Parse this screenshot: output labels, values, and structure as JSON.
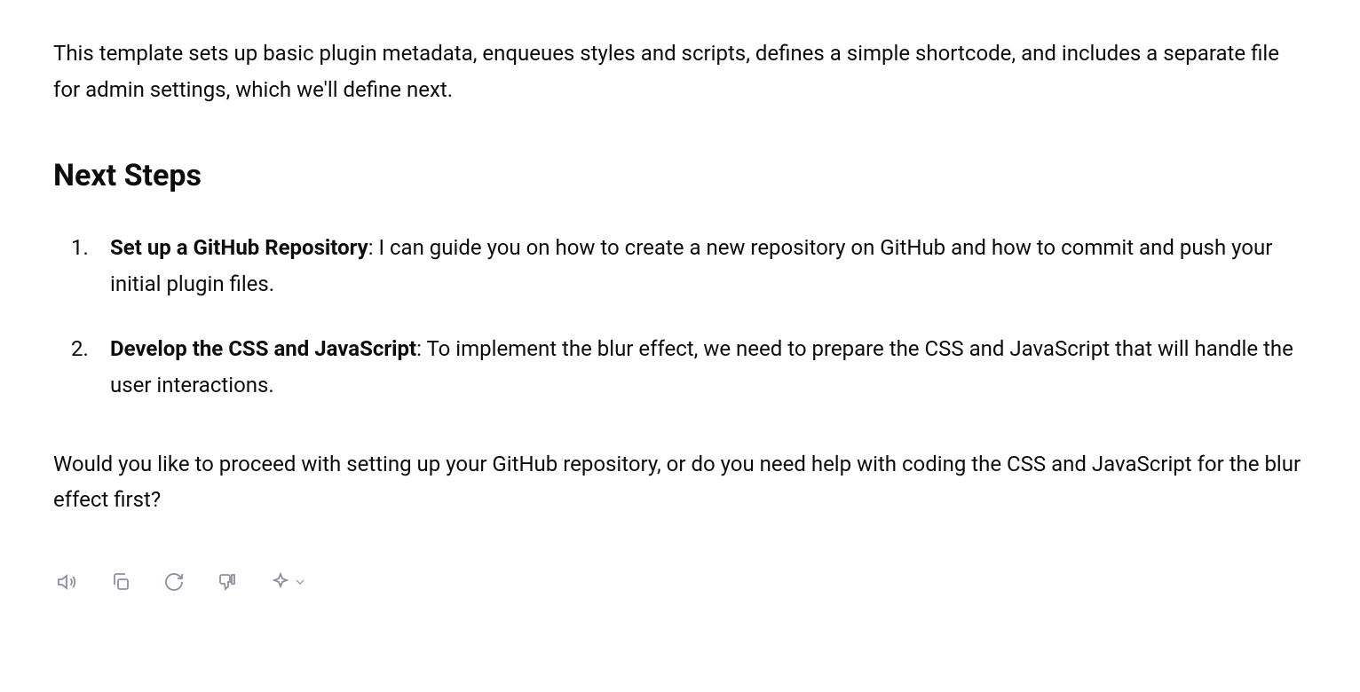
{
  "intro": "This template sets up basic plugin metadata, enqueues styles and scripts, defines a simple shortcode, and includes a separate file for admin settings, which we'll define next.",
  "heading": "Next Steps",
  "steps": [
    {
      "bold": "Set up a GitHub Repository",
      "rest": ": I can guide you on how to create a new repository on GitHub and how to commit and push your initial plugin files."
    },
    {
      "bold": "Develop the CSS and JavaScript",
      "rest": ": To implement the blur effect, we need to prepare the CSS and JavaScript that will handle the user interactions."
    }
  ],
  "closing": "Would you like to proceed with setting up your GitHub repository, or do you need help with coding the CSS and JavaScript for the blur effect first?"
}
